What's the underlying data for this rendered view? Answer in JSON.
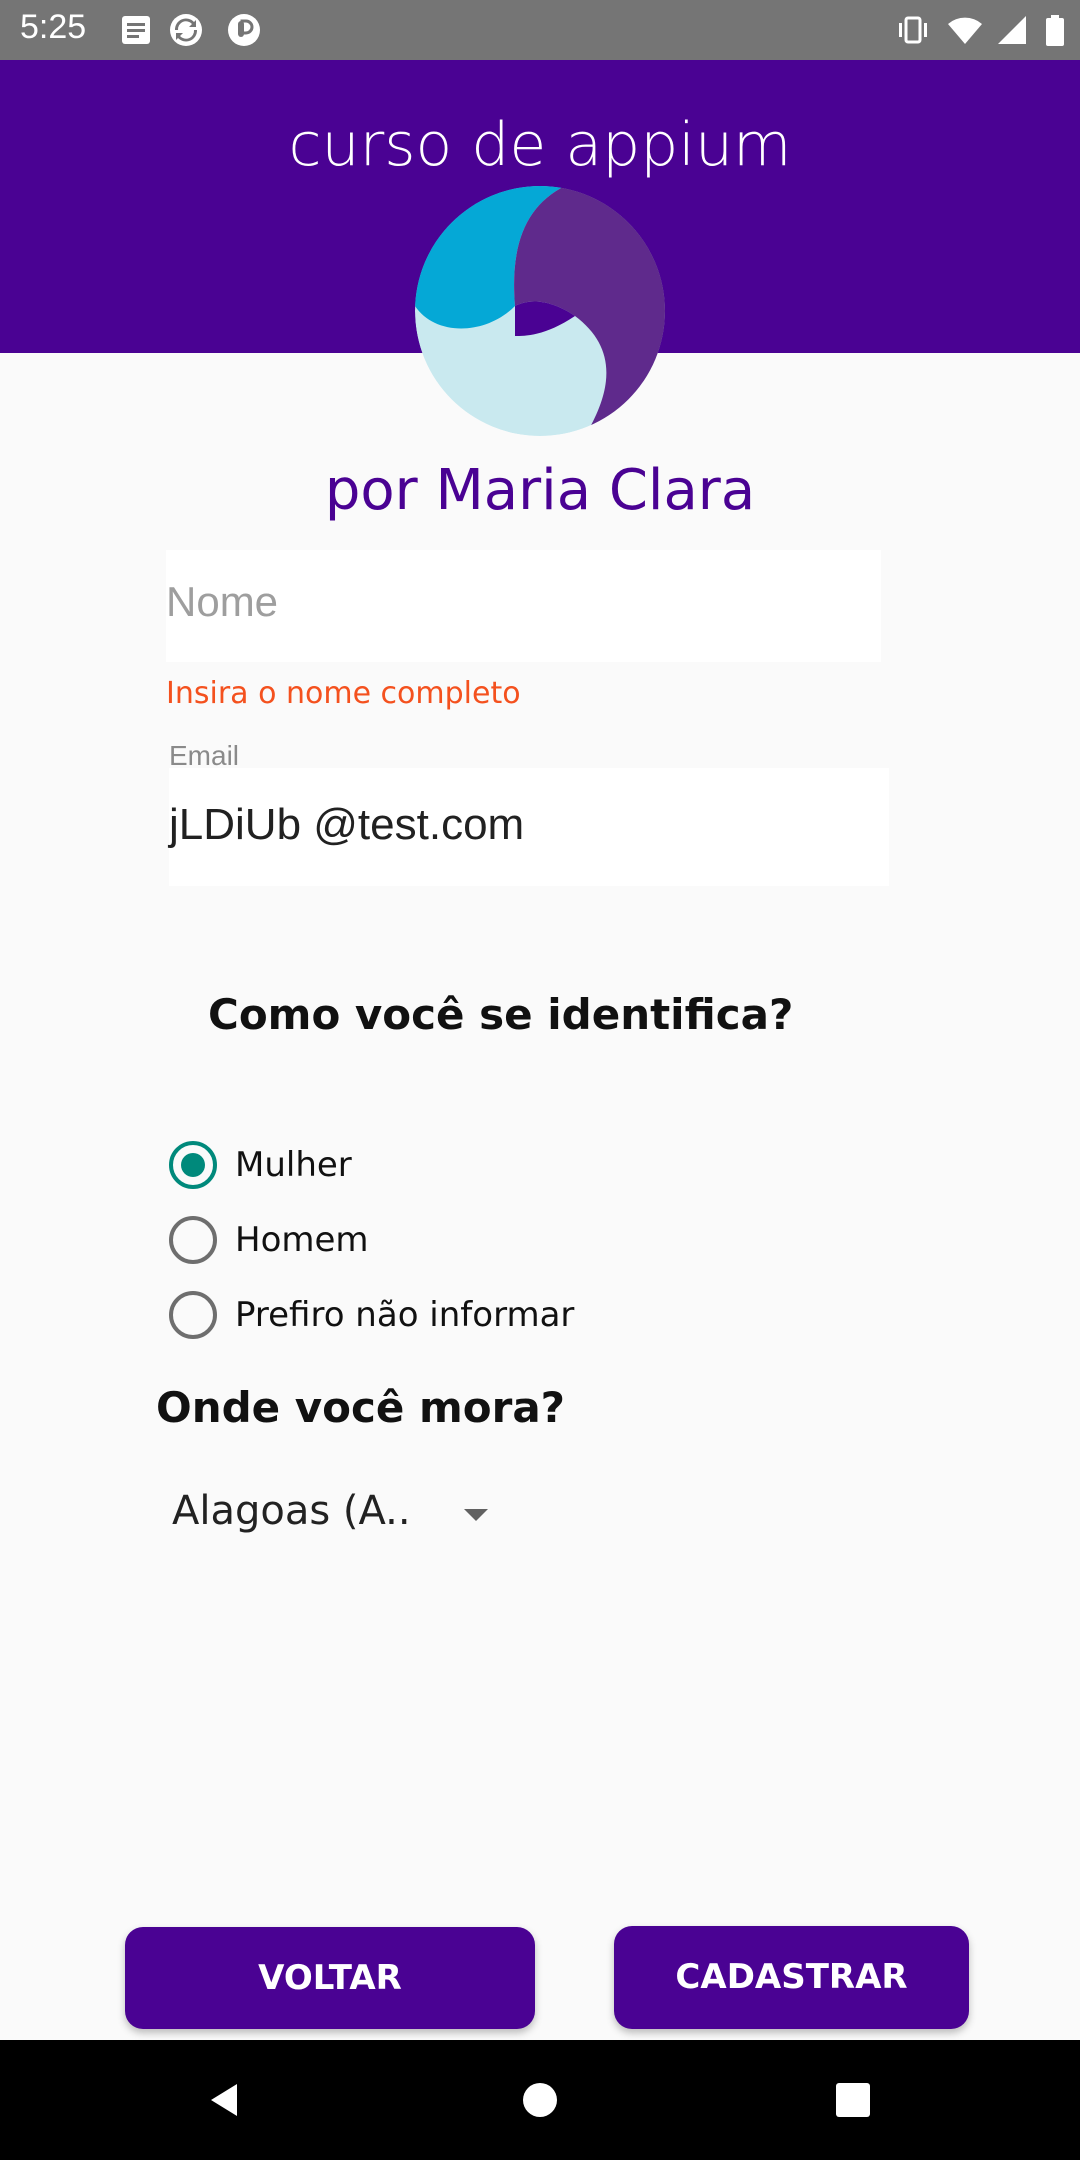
{
  "status_bar": {
    "time": "5:25",
    "left_icons": [
      "document-icon",
      "sync-icon",
      "pocket-icon"
    ],
    "right_icons": [
      "vibrate-icon",
      "wifi-icon",
      "signal-icon",
      "battery-icon"
    ]
  },
  "header": {
    "title": "curso de appium",
    "background_color": "#4a0293"
  },
  "logo": {
    "icon": "app-logo",
    "colors": [
      "#05a8d6",
      "#5f2a8c",
      "#c9e9ef",
      "#4a0293"
    ]
  },
  "subtitle": "por Maria Clara",
  "form": {
    "name": {
      "placeholder": "Nome",
      "error": "Insira o nome completo"
    },
    "email": {
      "label": "Email",
      "value": "jLDiUb @test.com"
    },
    "gender": {
      "title": "Como você se identifica?",
      "options": [
        {
          "label": "Mulher",
          "selected": true
        },
        {
          "label": "Homem",
          "selected": false
        },
        {
          "label": "Prefiro não informar",
          "selected": false
        }
      ]
    },
    "location": {
      "title": "Onde você mora?",
      "selected": "Alagoas (A.."
    }
  },
  "buttons": {
    "back": "VOLTAR",
    "submit": "CADASTRAR"
  },
  "nav_bar": {
    "icons": [
      "back-icon",
      "home-icon",
      "recents-icon"
    ]
  },
  "colors": {
    "primary": "#4a0293",
    "accent": "#00897b",
    "error": "#f4511e"
  }
}
